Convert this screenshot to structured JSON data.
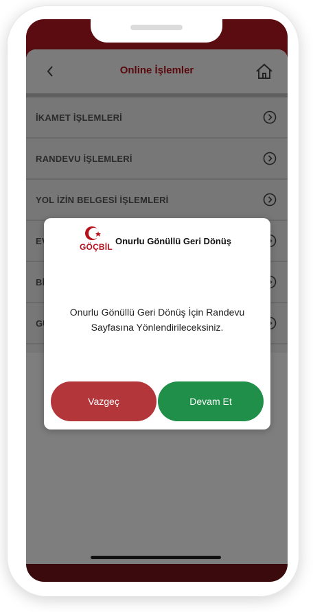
{
  "header": {
    "title": "Online İşlemler"
  },
  "menu": {
    "items": [
      {
        "label": "İKAMET İŞLEMLERİ"
      },
      {
        "label": "RANDEVU İŞLEMLERİ"
      },
      {
        "label": "YOL İZİN BELGESİ İŞLEMLERİ"
      },
      {
        "label": "EV"
      },
      {
        "label": "Bİ"
      },
      {
        "label": "GÜ"
      }
    ]
  },
  "modal": {
    "logo_text": "GÖÇBİL",
    "title": "Onurlu Gönüllü Geri Dönüş",
    "message": "Onurlu Gönüllü Geri Dönüş İçin Randevu Sayfasına Yönlendirileceksiniz.",
    "cancel_label": "Vazgeç",
    "continue_label": "Devam Et"
  },
  "colors": {
    "brand_dark_red": "#5a0a0e",
    "cancel": "#b3363b",
    "continue": "#1f8f4a"
  }
}
